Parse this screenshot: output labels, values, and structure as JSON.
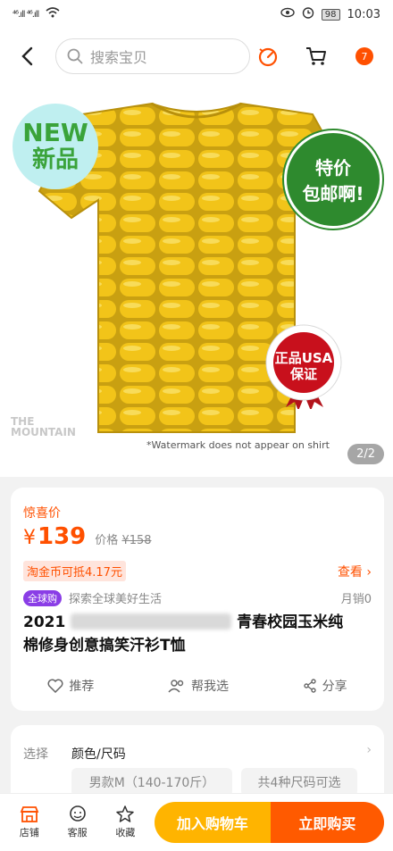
{
  "status": {
    "signal": "⁴⁶.ıll ⁴⁶.ıll",
    "battery": "98",
    "time": "10:03"
  },
  "topbar": {
    "search_placeholder": "搜索宝贝",
    "cart_icon": "cart-icon",
    "menu_badge": "7"
  },
  "hero": {
    "badge_new_en": "NEW",
    "badge_new_cn": "新品",
    "badge_sale_line1": "特价",
    "badge_sale_line2": "包邮啊!",
    "seal_line1": "正品USA",
    "seal_line2": "保证",
    "watermark_logo_1": "THE",
    "watermark_logo_2": "MOUNTAIN",
    "watermark_note": "*Watermark does not appear on shirt",
    "counter": "2/2"
  },
  "product": {
    "promo_label": "惊喜价",
    "currency": "¥",
    "price": "139",
    "orig_label": "价格",
    "orig_price": "¥158",
    "coin_offer": "淘金币可抵4.17元",
    "look_link": "查看 ›",
    "global_tag": "全球购",
    "global_text": "探索全球美好生活",
    "sales": "月销0",
    "title_prefix": "2021",
    "title_suffix": "青春校园玉米纯",
    "title_line2": "棉修身创意搞笑汗衫T恤",
    "recommend": "推荐",
    "help_choose": "帮我选",
    "share": "分享"
  },
  "options": {
    "label": "选择",
    "name": "颜色/尺码",
    "chip1": "男款M（140-170斤）",
    "chip2": "共4种尺码可选"
  },
  "bottom": {
    "store": "店铺",
    "service": "客服",
    "favorite": "收藏",
    "add_cart": "加入购物车",
    "buy_now": "立即购买"
  },
  "colors": {
    "accent": "#ff5000",
    "cart": "#ffb400",
    "buy": "#ff5a00",
    "corn": "#f2c419"
  }
}
